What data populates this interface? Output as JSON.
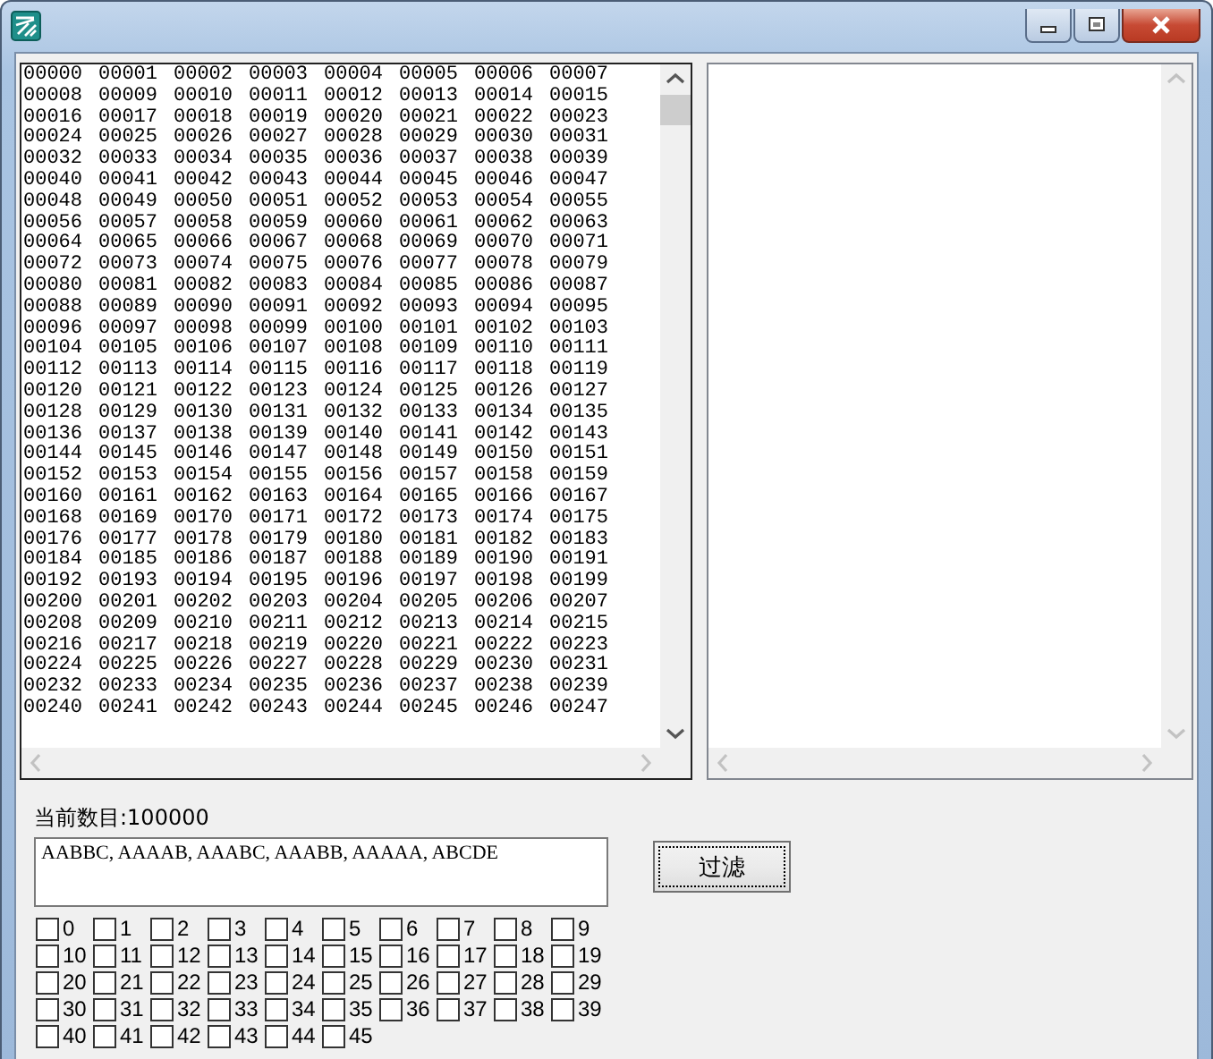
{
  "window": {
    "buttons": [
      {
        "kind": "minimize"
      },
      {
        "kind": "maximize"
      },
      {
        "kind": "close"
      }
    ]
  },
  "left_list": {
    "rows": [
      [
        "00000",
        "00001",
        "00002",
        "00003",
        "00004",
        "00005",
        "00006",
        "00007"
      ],
      [
        "00008",
        "00009",
        "00010",
        "00011",
        "00012",
        "00013",
        "00014",
        "00015"
      ],
      [
        "00016",
        "00017",
        "00018",
        "00019",
        "00020",
        "00021",
        "00022",
        "00023"
      ],
      [
        "00024",
        "00025",
        "00026",
        "00027",
        "00028",
        "00029",
        "00030",
        "00031"
      ],
      [
        "00032",
        "00033",
        "00034",
        "00035",
        "00036",
        "00037",
        "00038",
        "00039"
      ],
      [
        "00040",
        "00041",
        "00042",
        "00043",
        "00044",
        "00045",
        "00046",
        "00047"
      ],
      [
        "00048",
        "00049",
        "00050",
        "00051",
        "00052",
        "00053",
        "00054",
        "00055"
      ],
      [
        "00056",
        "00057",
        "00058",
        "00059",
        "00060",
        "00061",
        "00062",
        "00063"
      ],
      [
        "00064",
        "00065",
        "00066",
        "00067",
        "00068",
        "00069",
        "00070",
        "00071"
      ],
      [
        "00072",
        "00073",
        "00074",
        "00075",
        "00076",
        "00077",
        "00078",
        "00079"
      ],
      [
        "00080",
        "00081",
        "00082",
        "00083",
        "00084",
        "00085",
        "00086",
        "00087"
      ],
      [
        "00088",
        "00089",
        "00090",
        "00091",
        "00092",
        "00093",
        "00094",
        "00095"
      ],
      [
        "00096",
        "00097",
        "00098",
        "00099",
        "00100",
        "00101",
        "00102",
        "00103"
      ],
      [
        "00104",
        "00105",
        "00106",
        "00107",
        "00108",
        "00109",
        "00110",
        "00111"
      ],
      [
        "00112",
        "00113",
        "00114",
        "00115",
        "00116",
        "00117",
        "00118",
        "00119"
      ],
      [
        "00120",
        "00121",
        "00122",
        "00123",
        "00124",
        "00125",
        "00126",
        "00127"
      ],
      [
        "00128",
        "00129",
        "00130",
        "00131",
        "00132",
        "00133",
        "00134",
        "00135"
      ],
      [
        "00136",
        "00137",
        "00138",
        "00139",
        "00140",
        "00141",
        "00142",
        "00143"
      ],
      [
        "00144",
        "00145",
        "00146",
        "00147",
        "00148",
        "00149",
        "00150",
        "00151"
      ],
      [
        "00152",
        "00153",
        "00154",
        "00155",
        "00156",
        "00157",
        "00158",
        "00159"
      ],
      [
        "00160",
        "00161",
        "00162",
        "00163",
        "00164",
        "00165",
        "00166",
        "00167"
      ],
      [
        "00168",
        "00169",
        "00170",
        "00171",
        "00172",
        "00173",
        "00174",
        "00175"
      ],
      [
        "00176",
        "00177",
        "00178",
        "00179",
        "00180",
        "00181",
        "00182",
        "00183"
      ],
      [
        "00184",
        "00185",
        "00186",
        "00187",
        "00188",
        "00189",
        "00190",
        "00191"
      ],
      [
        "00192",
        "00193",
        "00194",
        "00195",
        "00196",
        "00197",
        "00198",
        "00199"
      ],
      [
        "00200",
        "00201",
        "00202",
        "00203",
        "00204",
        "00205",
        "00206",
        "00207"
      ],
      [
        "00208",
        "00209",
        "00210",
        "00211",
        "00212",
        "00213",
        "00214",
        "00215"
      ],
      [
        "00216",
        "00217",
        "00218",
        "00219",
        "00220",
        "00221",
        "00222",
        "00223"
      ],
      [
        "00224",
        "00225",
        "00226",
        "00227",
        "00228",
        "00229",
        "00230",
        "00231"
      ],
      [
        "00232",
        "00233",
        "00234",
        "00235",
        "00236",
        "00237",
        "00238",
        "00239"
      ],
      [
        "00240",
        "00241",
        "00242",
        "00243",
        "00244",
        "00245",
        "00246",
        "00247"
      ]
    ]
  },
  "count_label": {
    "caption": "当前数目:",
    "value": "100000"
  },
  "filter_field": {
    "value": "AABBC, AAAAB, AAABC, AAABB, AAAAA, ABCDE"
  },
  "filter_button": {
    "label": "过滤"
  },
  "checkboxes": [
    {
      "label": "0",
      "checked": false
    },
    {
      "label": "1",
      "checked": false
    },
    {
      "label": "2",
      "checked": false
    },
    {
      "label": "3",
      "checked": false
    },
    {
      "label": "4",
      "checked": false
    },
    {
      "label": "5",
      "checked": false
    },
    {
      "label": "6",
      "checked": false
    },
    {
      "label": "7",
      "checked": false
    },
    {
      "label": "8",
      "checked": false
    },
    {
      "label": "9",
      "checked": false
    },
    {
      "label": "10",
      "checked": false
    },
    {
      "label": "11",
      "checked": false
    },
    {
      "label": "12",
      "checked": false
    },
    {
      "label": "13",
      "checked": false
    },
    {
      "label": "14",
      "checked": false
    },
    {
      "label": "15",
      "checked": false
    },
    {
      "label": "16",
      "checked": false
    },
    {
      "label": "17",
      "checked": false
    },
    {
      "label": "18",
      "checked": false
    },
    {
      "label": "19",
      "checked": false
    },
    {
      "label": "20",
      "checked": false
    },
    {
      "label": "21",
      "checked": false
    },
    {
      "label": "22",
      "checked": false
    },
    {
      "label": "23",
      "checked": false
    },
    {
      "label": "24",
      "checked": false
    },
    {
      "label": "25",
      "checked": false
    },
    {
      "label": "26",
      "checked": false
    },
    {
      "label": "27",
      "checked": false
    },
    {
      "label": "28",
      "checked": false
    },
    {
      "label": "29",
      "checked": false
    },
    {
      "label": "30",
      "checked": false
    },
    {
      "label": "31",
      "checked": false
    },
    {
      "label": "32",
      "checked": false
    },
    {
      "label": "33",
      "checked": false
    },
    {
      "label": "34",
      "checked": false
    },
    {
      "label": "35",
      "checked": false
    },
    {
      "label": "36",
      "checked": false
    },
    {
      "label": "37",
      "checked": false
    },
    {
      "label": "38",
      "checked": false
    },
    {
      "label": "39",
      "checked": false
    },
    {
      "label": "40",
      "checked": false
    },
    {
      "label": "41",
      "checked": false
    },
    {
      "label": "42",
      "checked": false
    },
    {
      "label": "43",
      "checked": false
    },
    {
      "label": "44",
      "checked": false
    },
    {
      "label": "45",
      "checked": false
    }
  ]
}
